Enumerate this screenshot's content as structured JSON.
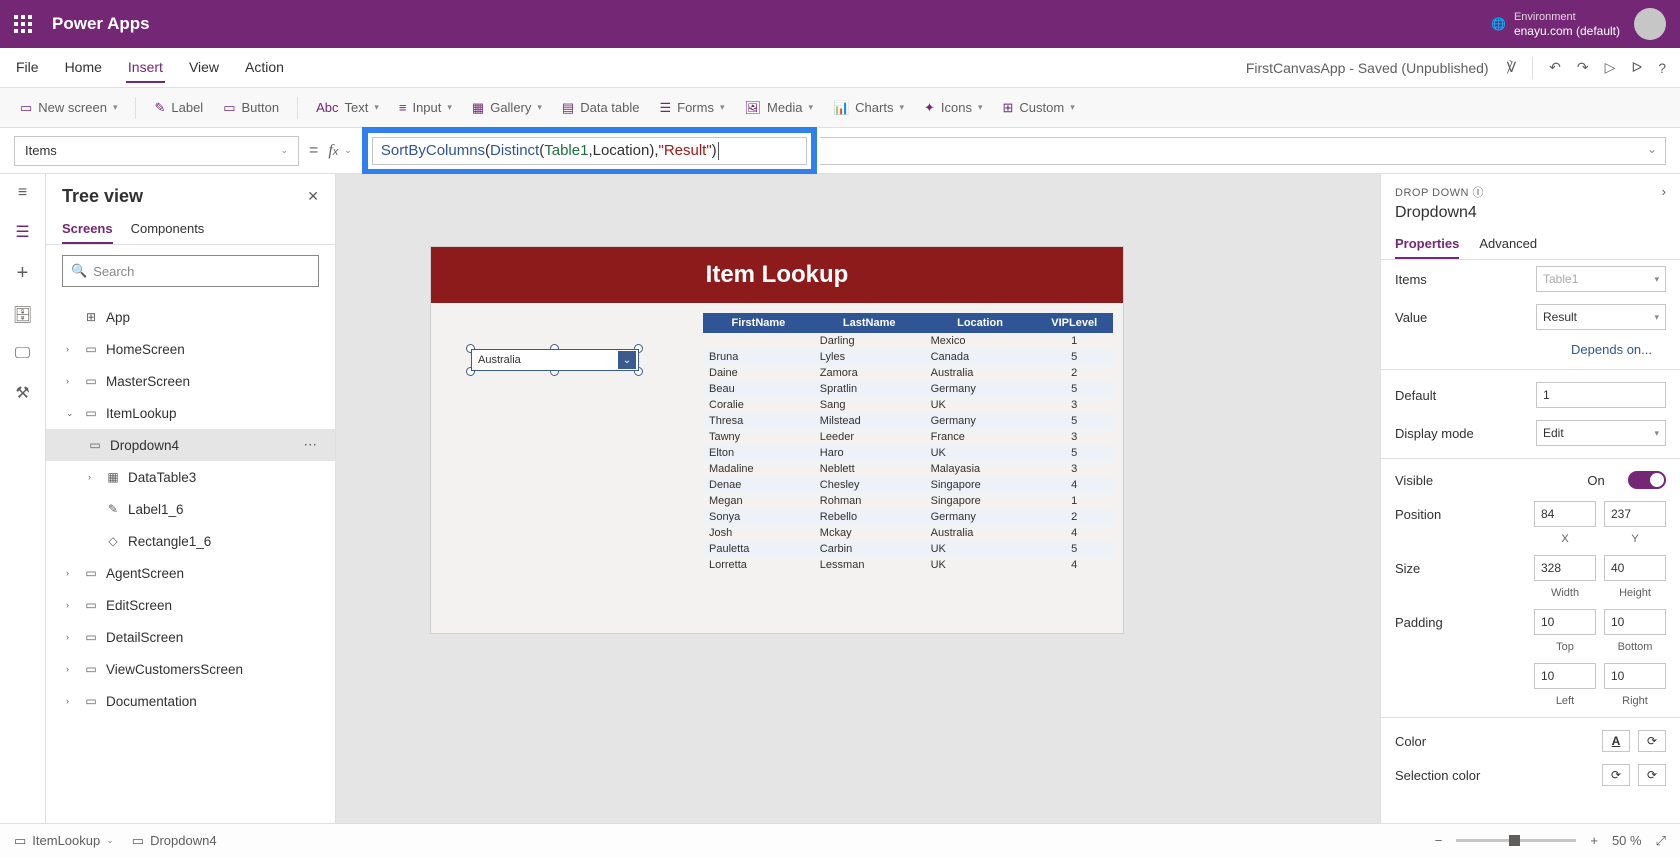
{
  "titlebar": {
    "brand": "Power Apps",
    "env_label": "Environment",
    "env_value": "enayu.com (default)"
  },
  "menus": {
    "file": "File",
    "home": "Home",
    "insert": "Insert",
    "view": "View",
    "action": "Action"
  },
  "status": {
    "appname": "FirstCanvasApp - Saved (Unpublished)"
  },
  "toolbar": {
    "newscreen": "New screen",
    "label": "Label",
    "button": "Button",
    "text": "Text",
    "input": "Input",
    "gallery": "Gallery",
    "datatable": "Data table",
    "forms": "Forms",
    "media": "Media",
    "charts": "Charts",
    "icons": "Icons",
    "custom": "Custom"
  },
  "formula": {
    "property": "Items",
    "fn1": "SortByColumns",
    "fn2": "Distinct",
    "arg1": "Table1",
    "arg2": "Location",
    "arg3": "\"Result\""
  },
  "tree": {
    "title": "Tree view",
    "tab_screens": "Screens",
    "tab_components": "Components",
    "search_ph": "Search",
    "app": "App",
    "home": "HomeScreen",
    "master": "MasterScreen",
    "itemlookup": "ItemLookup",
    "dropdown": "Dropdown4",
    "datatable": "DataTable3",
    "label": "Label1_6",
    "rect": "Rectangle1_6",
    "agent": "AgentScreen",
    "edit": "EditScreen",
    "detail": "DetailScreen",
    "viewcust": "ViewCustomersScreen",
    "doc": "Documentation"
  },
  "canvas": {
    "title": "Item Lookup",
    "dropdown_value": "Australia",
    "columns": {
      "c1": "FirstName",
      "c2": "LastName",
      "c3": "Location",
      "c4": "VIPLevel"
    },
    "rows": [
      {
        "fn": "",
        "ln": "Darling",
        "loc": "Mexico",
        "vip": "1"
      },
      {
        "fn": "Bruna",
        "ln": "Lyles",
        "loc": "Canada",
        "vip": "5"
      },
      {
        "fn": "Daine",
        "ln": "Zamora",
        "loc": "Australia",
        "vip": "2"
      },
      {
        "fn": "Beau",
        "ln": "Spratlin",
        "loc": "Germany",
        "vip": "5"
      },
      {
        "fn": "Coralie",
        "ln": "Sang",
        "loc": "UK",
        "vip": "3"
      },
      {
        "fn": "Thresa",
        "ln": "Milstead",
        "loc": "Germany",
        "vip": "5"
      },
      {
        "fn": "Tawny",
        "ln": "Leeder",
        "loc": "France",
        "vip": "3"
      },
      {
        "fn": "Elton",
        "ln": "Haro",
        "loc": "UK",
        "vip": "5"
      },
      {
        "fn": "Madaline",
        "ln": "Neblett",
        "loc": "Malayasia",
        "vip": "3"
      },
      {
        "fn": "Denae",
        "ln": "Chesley",
        "loc": "Singapore",
        "vip": "4"
      },
      {
        "fn": "Megan",
        "ln": "Rohman",
        "loc": "Singapore",
        "vip": "1"
      },
      {
        "fn": "Sonya",
        "ln": "Rebello",
        "loc": "Germany",
        "vip": "2"
      },
      {
        "fn": "Josh",
        "ln": "Mckay",
        "loc": "Australia",
        "vip": "4"
      },
      {
        "fn": "Pauletta",
        "ln": "Carbin",
        "loc": "UK",
        "vip": "5"
      },
      {
        "fn": "Lorretta",
        "ln": "Lessman",
        "loc": "UK",
        "vip": "4"
      }
    ]
  },
  "props": {
    "type_label": "DROP DOWN",
    "control_name": "Dropdown4",
    "tab_props": "Properties",
    "tab_adv": "Advanced",
    "items_label": "Items",
    "items_val": "Table1",
    "value_label": "Value",
    "value_val": "Result",
    "depends": "Depends on...",
    "default_label": "Default",
    "default_val": "1",
    "display_label": "Display mode",
    "display_val": "Edit",
    "visible_label": "Visible",
    "visible_val": "On",
    "position_label": "Position",
    "pos_x": "84",
    "pos_y": "237",
    "pos_xl": "X",
    "pos_yl": "Y",
    "size_label": "Size",
    "size_w": "328",
    "size_h": "40",
    "size_wl": "Width",
    "size_hl": "Height",
    "padding_label": "Padding",
    "pad_t": "10",
    "pad_b": "10",
    "pad_tl": "Top",
    "pad_bl": "Bottom",
    "pad_l": "10",
    "pad_r": "10",
    "pad_ll": "Left",
    "pad_rl": "Right",
    "color_label": "Color",
    "sel_color_label": "Selection color",
    "color_a": "A"
  },
  "breadcrumb": {
    "screen": "ItemLookup",
    "control": "Dropdown4",
    "zoom": "50",
    "pct": "%",
    "plus": "+",
    "minus": "−"
  }
}
